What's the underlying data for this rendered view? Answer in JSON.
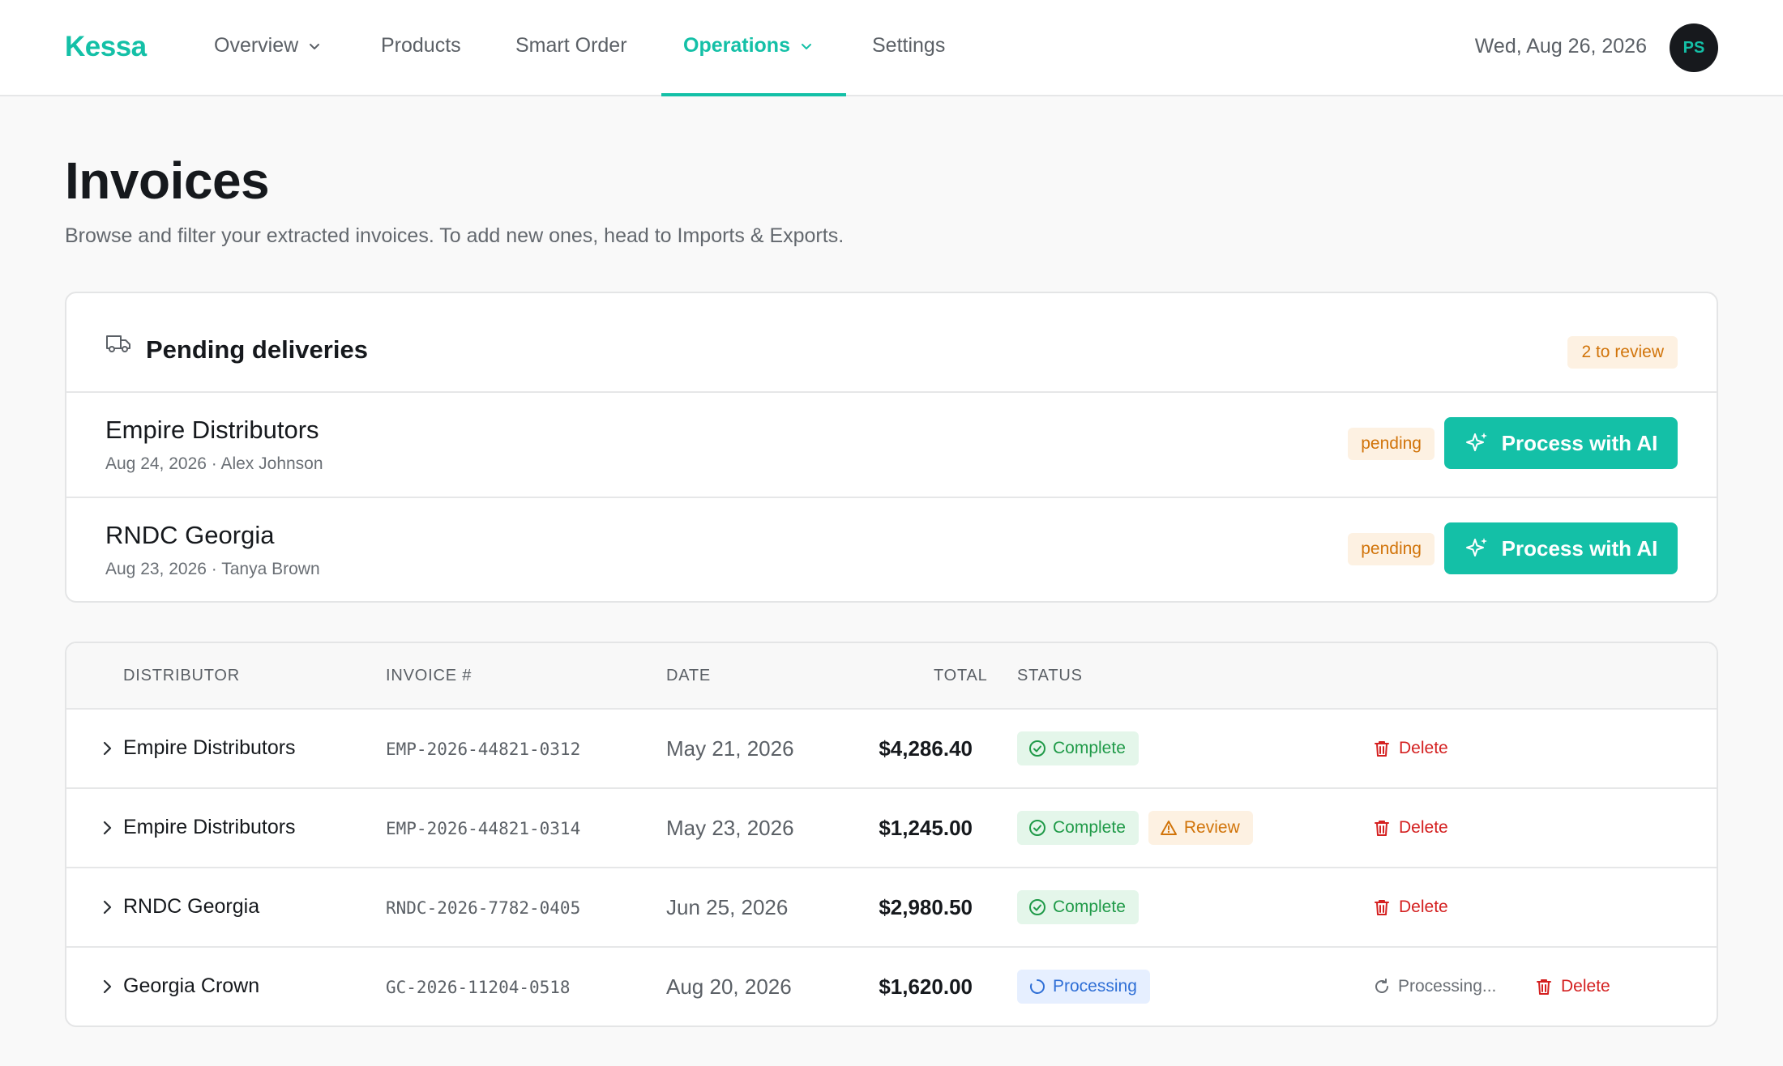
{
  "nav": {
    "logo": "Kessa",
    "items": [
      {
        "label": "Overview",
        "has_dropdown": true,
        "active": false
      },
      {
        "label": "Products",
        "has_dropdown": false,
        "active": false
      },
      {
        "label": "Smart Order",
        "has_dropdown": false,
        "active": false
      },
      {
        "label": "Operations",
        "has_dropdown": true,
        "active": true
      },
      {
        "label": "Settings",
        "has_dropdown": false,
        "active": false
      }
    ],
    "date": "Wed, Aug 26, 2026",
    "avatar_initials": "PS"
  },
  "page": {
    "title": "Invoices",
    "subtitle": "Browse and filter your extracted invoices. To add new ones, head to Imports & Exports."
  },
  "pending": {
    "icon": "truck-icon",
    "title": "Pending deliveries",
    "review_badge": "2 to review",
    "rows": [
      {
        "name": "Empire Distributors",
        "meta": "Aug 24, 2026 · Alex Johnson",
        "status": "pending",
        "action": "Process with AI"
      },
      {
        "name": "RNDC Georgia",
        "meta": "Aug 23, 2026 · Tanya Brown",
        "status": "pending",
        "action": "Process with AI"
      }
    ]
  },
  "table": {
    "headers": {
      "distributor": "DISTRIBUTOR",
      "invoice": "INVOICE #",
      "date": "DATE",
      "total": "TOTAL",
      "status": "STATUS"
    },
    "rows": [
      {
        "distributor": "Empire Distributors",
        "invoice": "EMP-2026-44821-0312",
        "date": "May 21, 2026",
        "total": "$4,286.40",
        "status": "Complete",
        "delete": "Delete"
      },
      {
        "distributor": "Empire Distributors",
        "invoice": "EMP-2026-44821-0314",
        "date": "May 23, 2026",
        "total": "$1,245.00",
        "status": "Complete",
        "extra_status": "Review",
        "delete": "Delete"
      },
      {
        "distributor": "RNDC Georgia",
        "invoice": "RNDC-2026-7782-0405",
        "date": "Jun 25, 2026",
        "total": "$2,980.50",
        "status": "Complete",
        "delete": "Delete"
      },
      {
        "distributor": "Georgia Crown",
        "invoice": "GC-2026-11204-0518",
        "date": "Aug 20, 2026",
        "total": "$1,620.00",
        "status": "Processing",
        "processing_text": "Processing...",
        "delete": "Delete"
      }
    ]
  },
  "colors": {
    "accent": "#14c0a7",
    "pending": "#d1740a",
    "complete": "#1f9a48",
    "processing": "#2f6fd6",
    "delete": "#d42020"
  }
}
